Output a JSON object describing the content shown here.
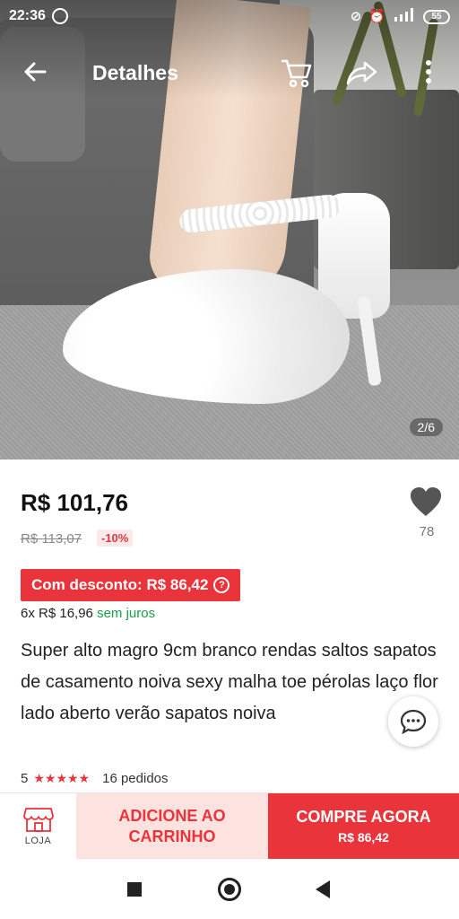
{
  "status_bar": {
    "time": "22:36",
    "battery": "55"
  },
  "app_bar": {
    "title": "Detalhes"
  },
  "gallery": {
    "counter": "2/6"
  },
  "product": {
    "price": "R$ 101,76",
    "original_price": "R$ 113,07",
    "discount": "-10%",
    "favorites_count": "78",
    "coupon_label": "Com desconto: R$ 86,42",
    "installments_prefix": "6x R$ 16,96",
    "installments_suffix": "sem juros",
    "title": "Super alto magro 9cm branco rendas saltos sapatos de casamento noiva sexy malha toe pérolas laço flor lado aberto verão sapatos noiva",
    "rating": "5",
    "stars": "★★★★★",
    "orders": "16 pedidos"
  },
  "actions": {
    "store_label": "LOJA",
    "add_to_cart": "ADICIONE AO CARRINHO",
    "buy_now": "COMPRE AGORA",
    "buy_now_price": "R$ 86,42"
  },
  "colors": {
    "accent": "#e8343a",
    "accent_light": "#fde3e0",
    "success": "#18a048"
  }
}
